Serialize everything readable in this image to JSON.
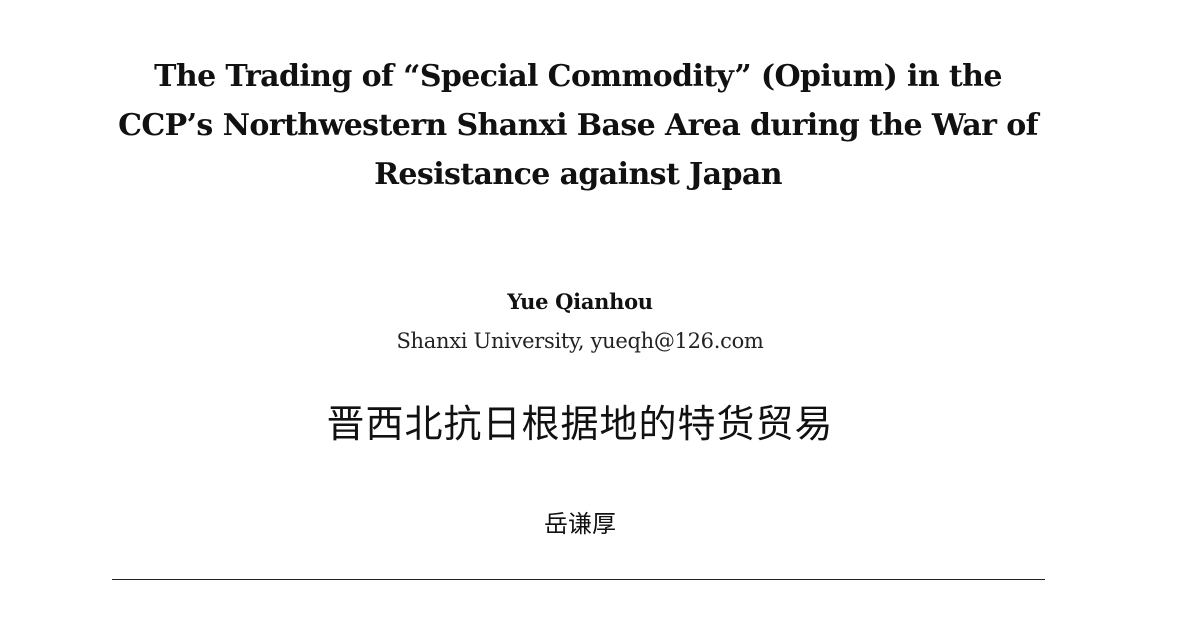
{
  "paper": {
    "title_lines": [
      "The Trading of “Special Commodity” (Opium) in the",
      "CCP’s Northwestern Shanxi Base Area during the War of",
      "Resistance against Japan"
    ],
    "author": "Yue Qianhou",
    "affiliation": "Shanxi University, yueqh@126.com",
    "chinese_title": "晋西北抗日根据地的特货贸易",
    "chinese_author": "岳谦厚"
  }
}
